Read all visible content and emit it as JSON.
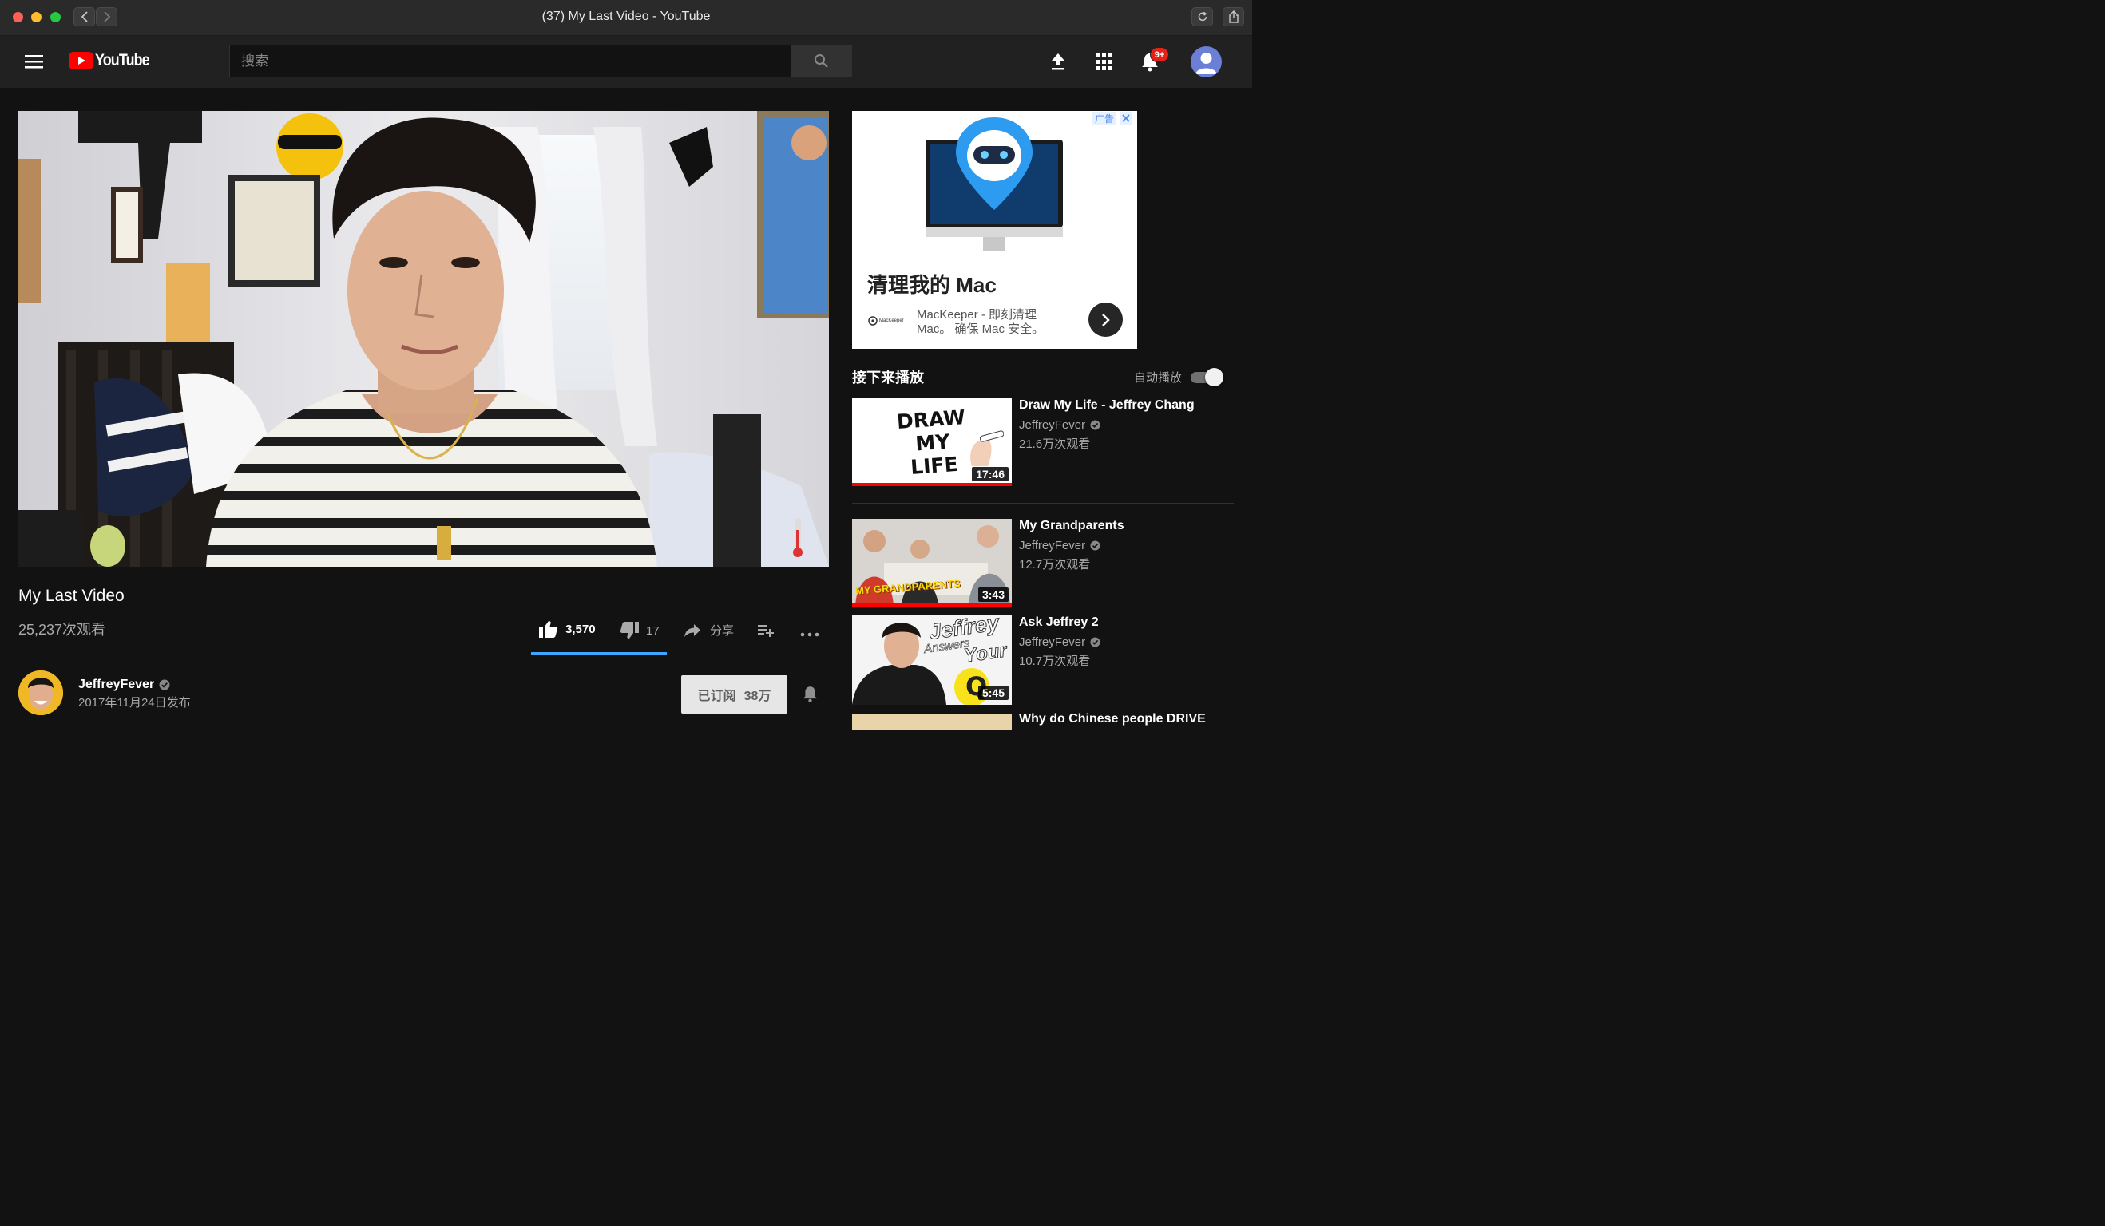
{
  "window": {
    "title": "(37) My Last Video - YouTube"
  },
  "masthead": {
    "logo_text": "YouTube",
    "search_placeholder": "搜索",
    "notifications_badge": "9+"
  },
  "video": {
    "title": "My Last Video",
    "views": "25,237次观看",
    "likes": "3,570",
    "dislikes": "17",
    "share_label": "分享",
    "like_ratio_fraction": 0.995
  },
  "channel": {
    "name": "JeffreyFever",
    "publish_date": "2017年11月24日发布",
    "subscribe_label": "已订阅",
    "subscriber_count": "38万"
  },
  "ad": {
    "tag": "广告",
    "headline": "清理我的 Mac",
    "description_line1": "MacKeeper - 即刻清理",
    "description_line2": "Mac。 确保 Mac 安全。",
    "brand": "MacKeeper"
  },
  "up_next": {
    "heading": "接下来播放",
    "autoplay_label": "自动播放",
    "autoplay_on": true,
    "items": [
      {
        "title": "Draw My Life - Jeffrey Chang",
        "channel": "JeffreyFever",
        "views": "21.6万次观看",
        "duration": "17:46",
        "thumb_text_1": "DRAW",
        "thumb_text_2": "MY",
        "thumb_text_3": "LIFE",
        "watched_fraction": 1.0
      },
      {
        "title": "My Grandparents",
        "channel": "JeffreyFever",
        "views": "12.7万次观看",
        "duration": "3:43",
        "thumb_text_1": "MY GRANDPARENTS",
        "watched_fraction": 1.0
      },
      {
        "title": "Ask Jeffrey 2",
        "channel": "JeffreyFever",
        "views": "10.7万次观看",
        "duration": "5:45",
        "thumb_text_1": "Jeffrey",
        "thumb_text_2": "Answers",
        "thumb_text_3": "Your"
      },
      {
        "title": "Why do Chinese people DRIVE"
      }
    ]
  },
  "colors": {
    "brand_red": "#ff0000",
    "background": "#121212",
    "masthead": "#212121",
    "accent_blue": "#3ea6ff"
  }
}
